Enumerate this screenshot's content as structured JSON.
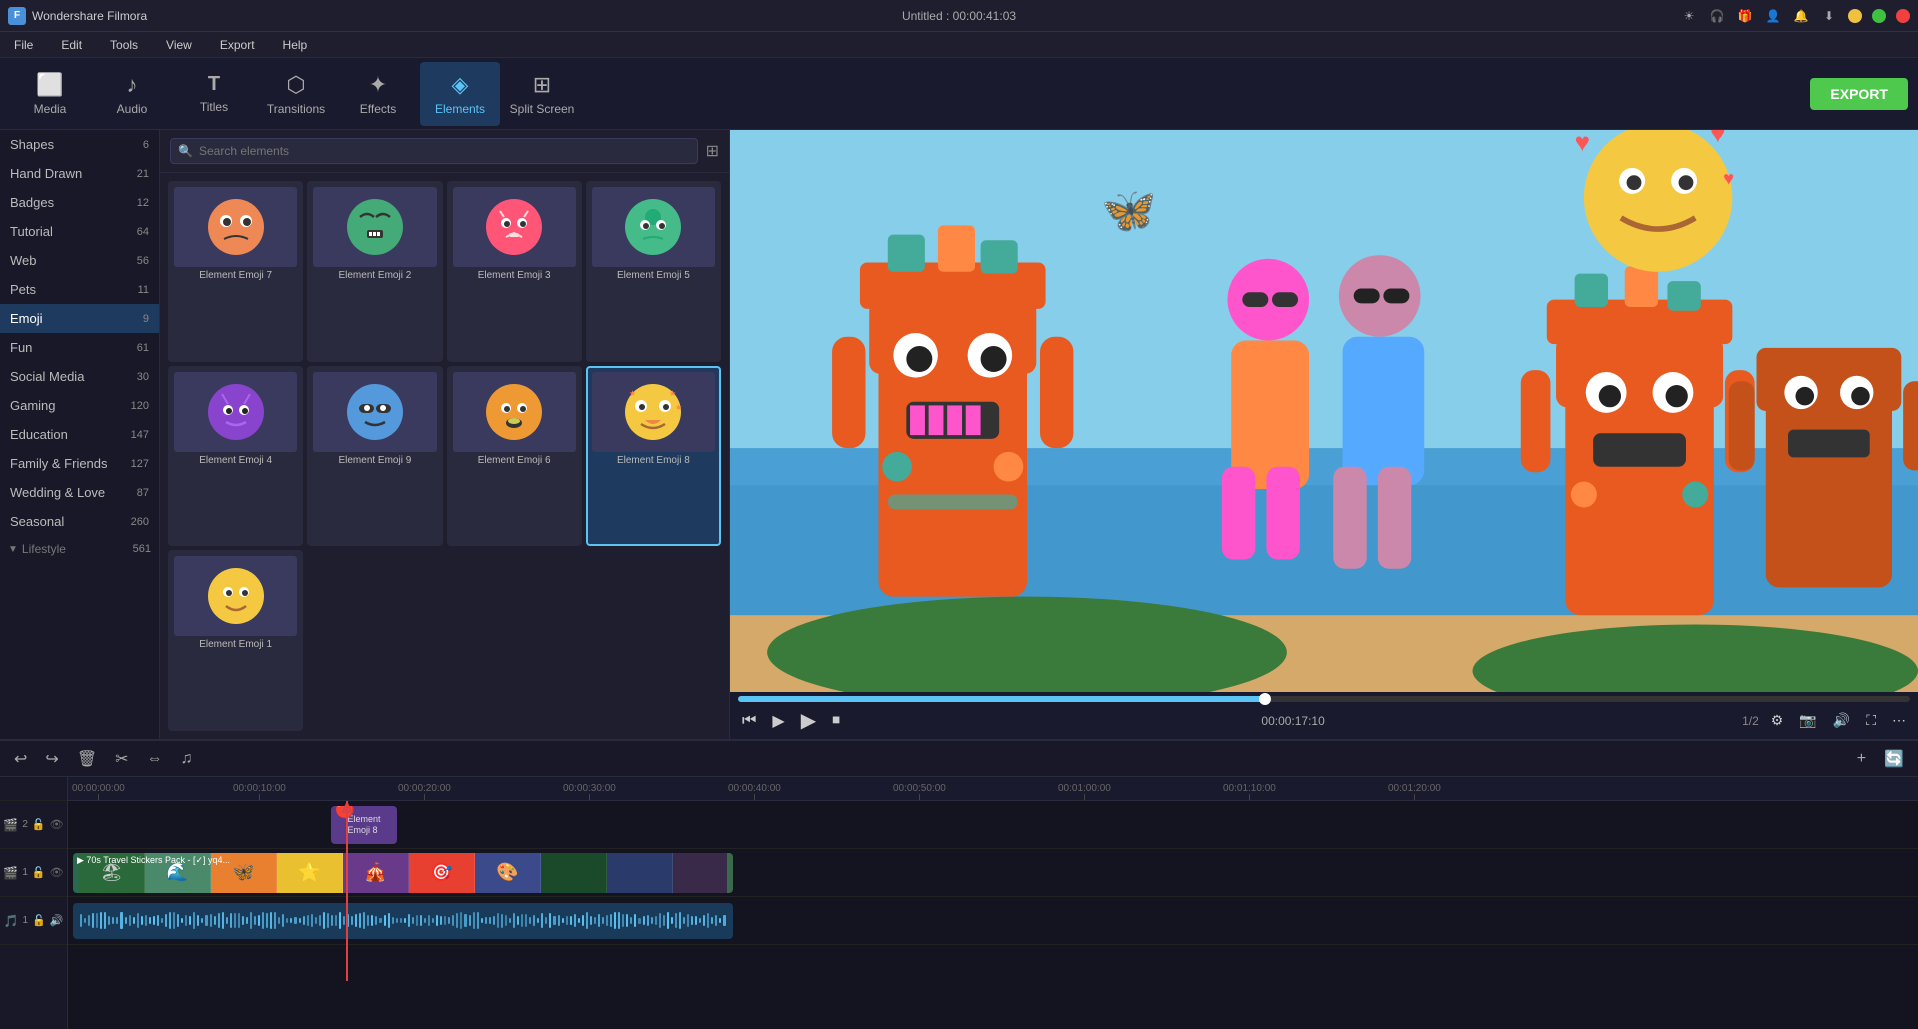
{
  "app": {
    "name": "Wondershare Filmora",
    "title": "Untitled : 00:00:41:03"
  },
  "titlebar": {
    "icons": [
      "brightness",
      "headphones",
      "gift",
      "person",
      "bell",
      "download"
    ],
    "window_controls": [
      "minimize",
      "maximize",
      "close"
    ]
  },
  "menubar": {
    "items": [
      "File",
      "Edit",
      "Tools",
      "View",
      "Export",
      "Help"
    ]
  },
  "toolbar": {
    "items": [
      {
        "id": "media",
        "label": "Media",
        "icon": "🎬"
      },
      {
        "id": "audio",
        "label": "Audio",
        "icon": "🎵"
      },
      {
        "id": "titles",
        "label": "Titles",
        "icon": "T"
      },
      {
        "id": "transitions",
        "label": "Transitions",
        "icon": "⬡"
      },
      {
        "id": "effects",
        "label": "Effects",
        "icon": "✨"
      },
      {
        "id": "elements",
        "label": "Elements",
        "icon": "◈"
      },
      {
        "id": "split-screen",
        "label": "Split Screen",
        "icon": "⊞"
      }
    ],
    "active": "elements",
    "export_label": "EXPORT"
  },
  "sidebar": {
    "items": [
      {
        "label": "Shapes",
        "count": 6
      },
      {
        "label": "Hand Drawn",
        "count": 21
      },
      {
        "label": "Badges",
        "count": 12
      },
      {
        "label": "Tutorial",
        "count": 64
      },
      {
        "label": "Web",
        "count": 56
      },
      {
        "label": "Pets",
        "count": 11
      },
      {
        "label": "Emoji",
        "count": 9,
        "active": true
      },
      {
        "label": "Fun",
        "count": 61
      },
      {
        "label": "Social Media",
        "count": 30
      },
      {
        "label": "Gaming",
        "count": 120
      },
      {
        "label": "Education",
        "count": 147
      },
      {
        "label": "Family & Friends",
        "count": 127
      },
      {
        "label": "Wedding & Love",
        "count": 87
      },
      {
        "label": "Seasonal",
        "count": 260
      },
      {
        "label": "Lifestyle",
        "count": 561
      }
    ]
  },
  "search": {
    "placeholder": "Search elements"
  },
  "elements": {
    "items": [
      {
        "id": "emoji7",
        "label": "Element Emoji 7",
        "emoji": "🟠"
      },
      {
        "id": "emoji2",
        "label": "Element Emoji 2",
        "emoji": "😤"
      },
      {
        "id": "emoji3",
        "label": "Element Emoji 3",
        "emoji": "👾"
      },
      {
        "id": "emoji5",
        "label": "Element Emoji 5",
        "emoji": "🤢"
      },
      {
        "id": "emoji4",
        "label": "Element Emoji 4",
        "emoji": "😈"
      },
      {
        "id": "emoji9",
        "label": "Element Emoji 9",
        "emoji": "😎"
      },
      {
        "id": "emoji6",
        "label": "Element Emoji 6",
        "emoji": "😮"
      },
      {
        "id": "emoji8",
        "label": "Element Emoji 8",
        "emoji": "🤩",
        "selected": true
      },
      {
        "id": "emoji1",
        "label": "Element Emoji 1",
        "emoji": "🙂"
      }
    ]
  },
  "preview": {
    "time_current": "00:00:17:10",
    "time_ratio": "1/2",
    "progress_pct": 45
  },
  "timeline": {
    "markers": [
      "00:00:00:00",
      "00:00:10:00",
      "00:00:20:00",
      "00:00:30:00",
      "00:00:40:00",
      "00:00:50:00",
      "00:01:00:00",
      "00:01:10:00",
      "00:01:20:00"
    ],
    "tracks": [
      {
        "id": "track2",
        "type": "video",
        "label": "🎬 2"
      },
      {
        "id": "track1",
        "type": "video",
        "label": "🎬 1"
      },
      {
        "id": "trackA1",
        "type": "audio",
        "label": "🎵 1"
      }
    ],
    "element_clip": {
      "label": "Element Emoji 8",
      "emoji": "🤩"
    },
    "video_clip": {
      "label": "70s Travel Stickers Pack - [✓] yq4...",
      "emojis": [
        "🏔️",
        "🌊",
        "🦋",
        "⭐",
        "🎪",
        "🎯",
        "🎨"
      ]
    }
  },
  "bottom_controls": {
    "snap_icon": "🧲",
    "add_track_icon": "➕",
    "loop_icon": "🔄"
  }
}
